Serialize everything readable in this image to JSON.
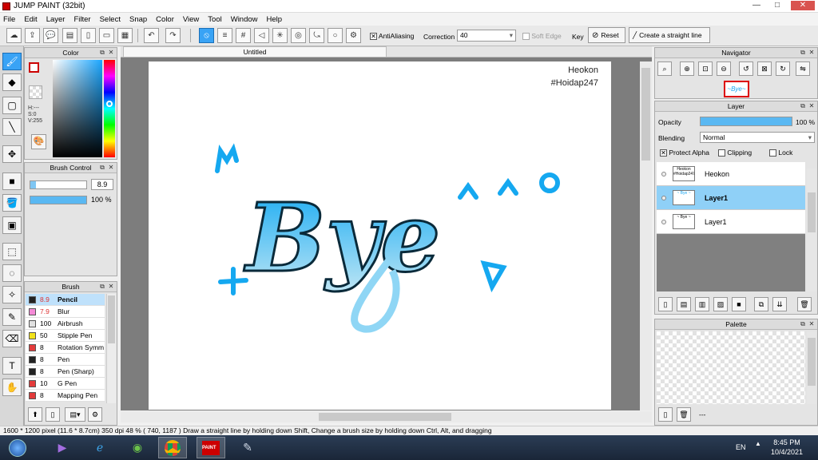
{
  "app": {
    "title": "JUMP PAINT (32bit)"
  },
  "window_buttons": {
    "minimize": "—",
    "maximize": "□",
    "close": "✕"
  },
  "menu": [
    "File",
    "Edit",
    "Layer",
    "Filter",
    "Select",
    "Snap",
    "Color",
    "View",
    "Tool",
    "Window",
    "Help"
  ],
  "toolbar": {
    "antialiasing_label": "AntiAliasing",
    "correction_label": "Correction",
    "correction_value": "40",
    "soft_edge_label": "Soft Edge",
    "key_label": "Key",
    "reset_label": "Reset",
    "straight_line_label": "Create a straight line"
  },
  "color_panel": {
    "title": "Color",
    "hsv": {
      "h": "H:---",
      "s": "S:0",
      "v": "V:255"
    },
    "primary_color": "#ffffff",
    "secondary_color": "#ffffff"
  },
  "brush_control": {
    "title": "Brush Control",
    "size": "8.9",
    "opacity": "100 %"
  },
  "brush_panel": {
    "title": "Brush",
    "items": [
      {
        "size": "8.9",
        "name": "Pencil",
        "color": "#222222"
      },
      {
        "size": "7.9",
        "name": "Blur",
        "color": "#f48ad6"
      },
      {
        "size": "100",
        "name": "Airbrush",
        "color": "#e0e0e0"
      },
      {
        "size": "50",
        "name": "Stipple Pen",
        "color": "#f2e21a"
      },
      {
        "size": "8",
        "name": "Rotation Symm",
        "color": "#e33b3b"
      },
      {
        "size": "8",
        "name": "Pen",
        "color": "#222222"
      },
      {
        "size": "8",
        "name": "Pen (Sharp)",
        "color": "#222222"
      },
      {
        "size": "10",
        "name": "G Pen",
        "color": "#e33b3b"
      },
      {
        "size": "8",
        "name": "Mapping Pen",
        "color": "#e33b3b"
      }
    ]
  },
  "document": {
    "tab_title": "Untitled",
    "watermark": {
      "line1": "Heokon",
      "line2": "#Hoidap247"
    },
    "artwork_text": "Bye"
  },
  "navigator": {
    "title": "Navigator"
  },
  "layer_panel": {
    "title": "Layer",
    "opacity_label": "Opacity",
    "opacity_value": "100 %",
    "blending_label": "Blending",
    "blending_value": "Normal",
    "protect_alpha_label": "Protect Alpha",
    "clipping_label": "Clipping",
    "lock_label": "Lock",
    "layers": [
      {
        "name": "Heokon",
        "selected": false
      },
      {
        "name": "Layer1",
        "selected": true
      },
      {
        "name": "Layer1",
        "selected": false
      }
    ]
  },
  "palette_panel": {
    "title": "Palette",
    "footer_text": "---"
  },
  "status_bar": {
    "text": "1600 * 1200 pixel   (11.6 * 8.7cm)   350 dpi   48 %   ( 740, 1187 )   Draw a straight line by holding down Shift, Change a brush size by holding down Ctrl, Alt, and dragging"
  },
  "taskbar": {
    "language": "EN",
    "time": "8:45 PM",
    "date": "10/4/2021"
  },
  "colors": {
    "accent": "#39a3f5",
    "selected_row": "#8fd0f7",
    "taskbar": "#1f2c40"
  }
}
